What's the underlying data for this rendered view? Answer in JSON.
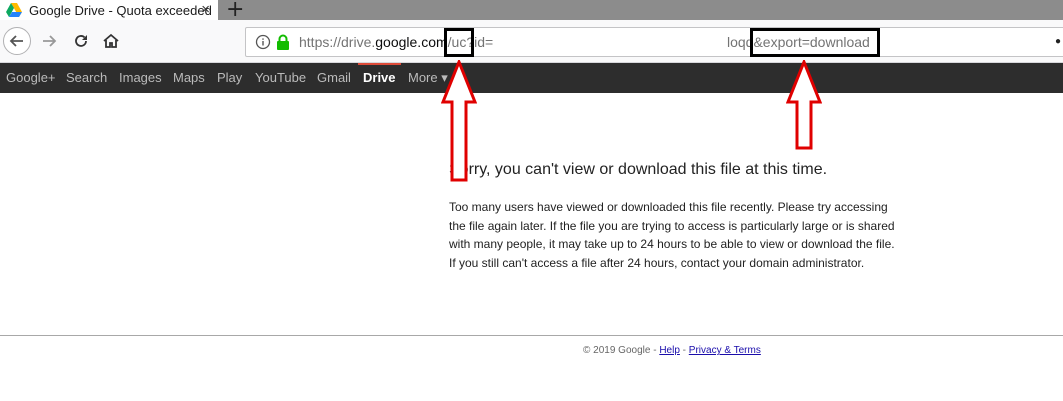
{
  "tab": {
    "title": "Google Drive - Quota exceeded",
    "close_label": "×",
    "new_tab_label": "+"
  },
  "toolbar": {
    "url_prefix": "https://drive.",
    "url_host": "google.com",
    "url_path": "/uc?id=",
    "url_tail": "loqq&export=download"
  },
  "gbar": {
    "items": [
      "Google+",
      "Search",
      "Images",
      "Maps",
      "Play",
      "YouTube",
      "Gmail",
      "Drive",
      "More ▾"
    ]
  },
  "message": {
    "title": "Sorry, you can't view or download this file at this time.",
    "body": "Too many users have viewed or downloaded this file recently. Please try accessing the file again later. If the file you are trying to access is particularly large or is shared with many people, it may take up to 24 hours to be able to view or download the file. If you still can't access a file after 24 hours, contact your domain administrator."
  },
  "footer": {
    "copyright": "© 2019 Google - ",
    "help": "Help",
    "separator": " - ",
    "privacy": "Privacy & Terms"
  },
  "colors": {
    "annotation_box": "#000000",
    "arrow": "#e00000",
    "gbar_bg": "#2d2d2d",
    "link": "#1a0dab"
  }
}
